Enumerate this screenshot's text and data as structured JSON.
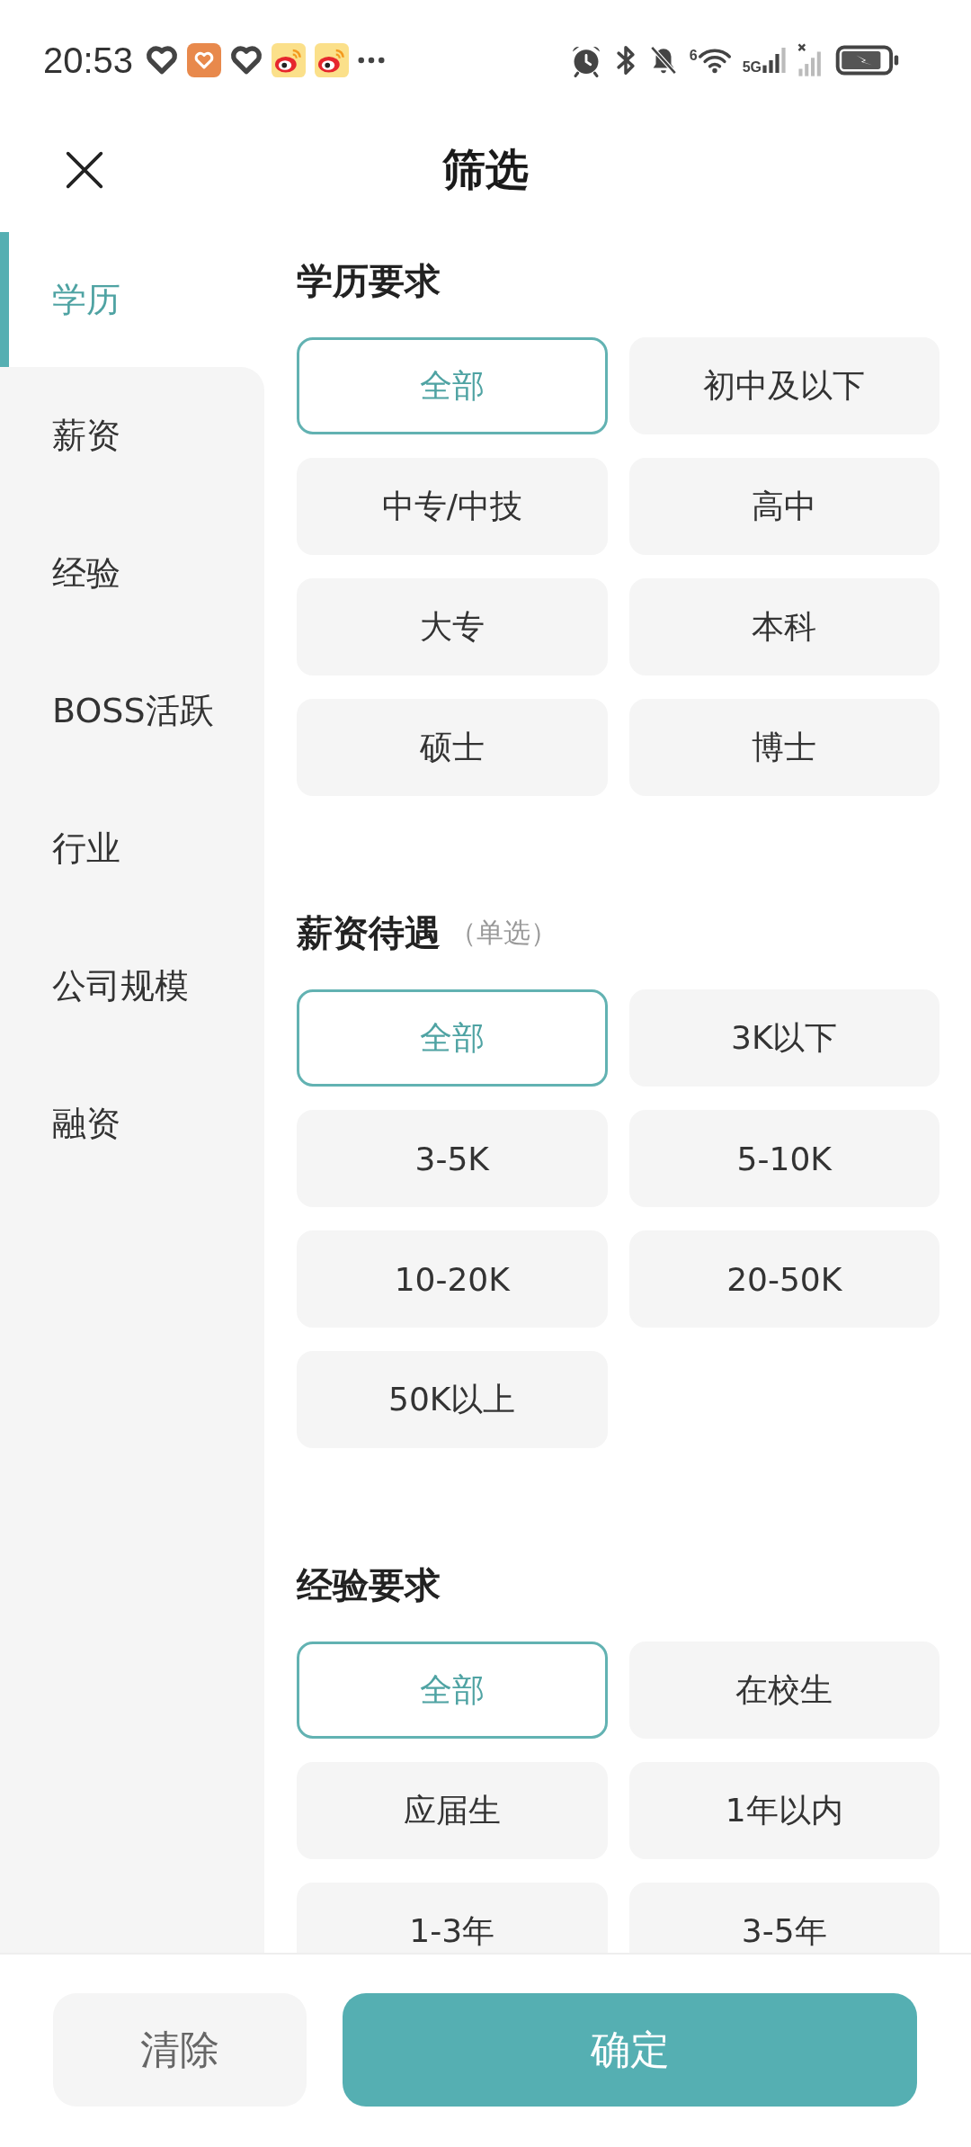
{
  "status_bar": {
    "time": "20:53",
    "wifi_standard": "6",
    "network": "5G"
  },
  "header": {
    "title": "筛选"
  },
  "sidebar": {
    "items": [
      {
        "label": "学历",
        "selected": true
      },
      {
        "label": "薪资",
        "selected": false
      },
      {
        "label": "经验",
        "selected": false
      },
      {
        "label": "BOSS活跃",
        "selected": false
      },
      {
        "label": "行业",
        "selected": false
      },
      {
        "label": "公司规模",
        "selected": false
      },
      {
        "label": "融资",
        "selected": false
      }
    ]
  },
  "sections": [
    {
      "title": "学历要求",
      "options": [
        {
          "label": "全部",
          "selected": true
        },
        {
          "label": "初中及以下",
          "selected": false
        },
        {
          "label": "中专/中技",
          "selected": false
        },
        {
          "label": "高中",
          "selected": false
        },
        {
          "label": "大专",
          "selected": false
        },
        {
          "label": "本科",
          "selected": false
        },
        {
          "label": "硕士",
          "selected": false
        },
        {
          "label": "博士",
          "selected": false
        }
      ]
    },
    {
      "title": "薪资待遇",
      "note": "（单选）",
      "options": [
        {
          "label": "全部",
          "selected": true
        },
        {
          "label": "3K以下",
          "selected": false
        },
        {
          "label": "3-5K",
          "selected": false
        },
        {
          "label": "5-10K",
          "selected": false
        },
        {
          "label": "10-20K",
          "selected": false
        },
        {
          "label": "20-50K",
          "selected": false
        },
        {
          "label": "50K以上",
          "selected": false
        }
      ]
    },
    {
      "title": "经验要求",
      "options": [
        {
          "label": "全部",
          "selected": true
        },
        {
          "label": "在校生",
          "selected": false
        },
        {
          "label": "应届生",
          "selected": false
        },
        {
          "label": "1年以内",
          "selected": false
        },
        {
          "label": "1-3年",
          "selected": false
        },
        {
          "label": "3-5年",
          "selected": false
        }
      ]
    }
  ],
  "footer": {
    "buttons": [
      {
        "label": "清除",
        "kind": "secondary"
      },
      {
        "label": "确定",
        "kind": "primary"
      }
    ]
  }
}
